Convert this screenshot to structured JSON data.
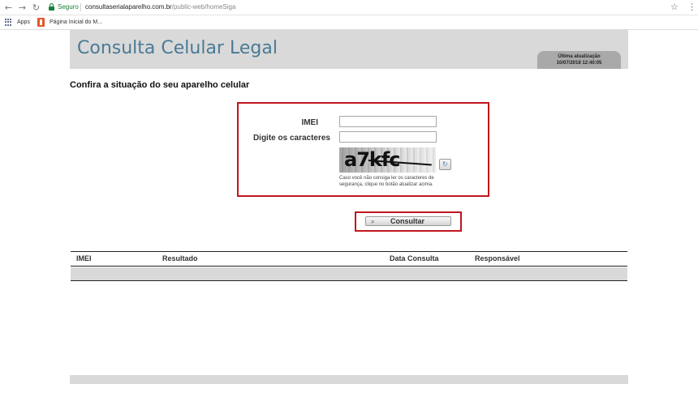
{
  "browser": {
    "secure_label": "Seguro",
    "url_host": "consultaserialaparelho.com.br",
    "url_path": "/public-web/homeSiga",
    "bookmarks": [
      {
        "label": "Apps"
      },
      {
        "label": "Página Inicial do M..."
      }
    ]
  },
  "header": {
    "title": "Consulta Celular Legal",
    "update_label": "Última atualização",
    "update_time": "10/07/2018 12:40:05"
  },
  "main": {
    "heading": "Confira a situação do seu aparelho celular",
    "form": {
      "imei_label": "IMEI",
      "imei_value": "",
      "chars_label": "Digite os caracteres",
      "chars_value": "",
      "captcha_text": "a7kfc",
      "refresh_icon": "refresh-icon",
      "hint": "Caso você não consiga ler os caracteres de segurança, clique no botão atualizar acima."
    },
    "submit": {
      "icon": "search-icon",
      "label": "Consultar"
    },
    "results": {
      "columns": [
        "IMEI",
        "Resultado",
        "Data Consulta",
        "Responsável"
      ],
      "rows": []
    }
  }
}
